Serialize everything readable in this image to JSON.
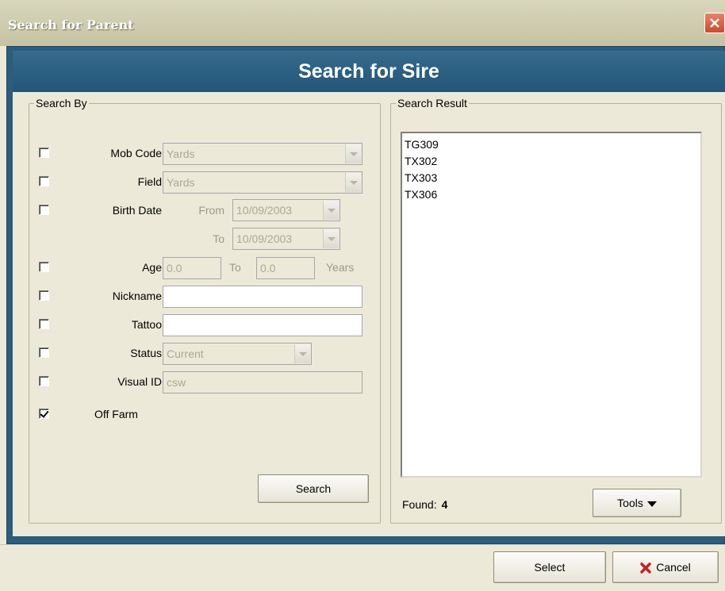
{
  "window": {
    "title": "Search for Parent"
  },
  "header": {
    "title": "Search for Sire"
  },
  "search_by": {
    "legend": "Search By",
    "mob_code": {
      "label": "Mob Code",
      "value": "Yards",
      "checked": false
    },
    "field": {
      "label": "Field",
      "value": "Yards",
      "checked": false
    },
    "birth_date": {
      "label": "Birth Date",
      "from_label": "From",
      "from_value": "10/09/2003",
      "to_label": "To",
      "to_value": "10/09/2003",
      "checked": false
    },
    "age": {
      "label": "Age",
      "from_value": "0.0",
      "to_label": "To",
      "to_value": "0.0",
      "unit": "Years",
      "checked": false
    },
    "nickname": {
      "label": "Nickname",
      "value": "",
      "checked": false
    },
    "tattoo": {
      "label": "Tattoo",
      "value": "",
      "checked": false
    },
    "status": {
      "label": "Status",
      "value": "Current",
      "checked": false
    },
    "visual_id": {
      "label": "Visual ID",
      "value": "csw",
      "checked": false
    },
    "off_farm": {
      "label": "Off Farm",
      "checked": true
    },
    "search_button": "Search"
  },
  "search_result": {
    "legend": "Search Result",
    "items": [
      "TG309",
      "TX302",
      "TX303",
      "TX306"
    ],
    "found_label": "Found:",
    "found_count": "4",
    "tools_button": "Tools"
  },
  "footer": {
    "select_button": "Select",
    "cancel_button": "Cancel"
  },
  "colors": {
    "header_bg": "#2b5d7e",
    "cancel_icon": "#c8201e"
  }
}
